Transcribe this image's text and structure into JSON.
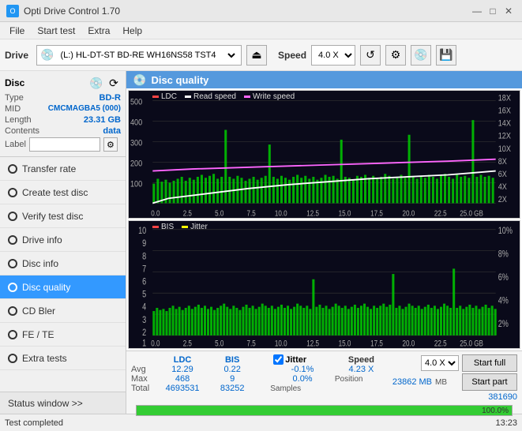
{
  "titlebar": {
    "title": "Opti Drive Control 1.70",
    "icon": "O",
    "controls": [
      "—",
      "□",
      "✕"
    ]
  },
  "menubar": {
    "items": [
      "File",
      "Start test",
      "Extra",
      "Help"
    ]
  },
  "toolbar": {
    "drive_label": "Drive",
    "drive_value": "(L:) HL-DT-ST BD-RE WH16NS58 TST4",
    "speed_label": "Speed",
    "speed_value": "4.0 X"
  },
  "disc": {
    "title": "Disc",
    "type_label": "Type",
    "type_value": "BD-R",
    "mid_label": "MID",
    "mid_value": "CMCMAGBA5 (000)",
    "length_label": "Length",
    "length_value": "23.31 GB",
    "contents_label": "Contents",
    "contents_value": "data",
    "label_label": "Label",
    "label_value": ""
  },
  "nav": {
    "items": [
      {
        "id": "transfer-rate",
        "label": "Transfer rate",
        "active": false
      },
      {
        "id": "create-test-disc",
        "label": "Create test disc",
        "active": false
      },
      {
        "id": "verify-test-disc",
        "label": "Verify test disc",
        "active": false
      },
      {
        "id": "drive-info",
        "label": "Drive info",
        "active": false
      },
      {
        "id": "disc-info",
        "label": "Disc info",
        "active": false
      },
      {
        "id": "disc-quality",
        "label": "Disc quality",
        "active": true
      },
      {
        "id": "cd-bler",
        "label": "CD Bler",
        "active": false
      },
      {
        "id": "fe-te",
        "label": "FE / TE",
        "active": false
      },
      {
        "id": "extra-tests",
        "label": "Extra tests",
        "active": false
      }
    ]
  },
  "status_window": "Status window >>",
  "disc_quality": {
    "title": "Disc quality",
    "chart1": {
      "legend": [
        {
          "label": "LDC",
          "color": "#ff4444"
        },
        {
          "label": "Read speed",
          "color": "#ffffff"
        },
        {
          "label": "Write speed",
          "color": "#ff66ff"
        }
      ],
      "y_left": [
        "500",
        "400",
        "300",
        "200",
        "100"
      ],
      "y_right": [
        "18X",
        "16X",
        "14X",
        "12X",
        "10X",
        "8X",
        "6X",
        "4X",
        "2X"
      ],
      "x_labels": [
        "0.0",
        "2.5",
        "5.0",
        "7.5",
        "10.0",
        "12.5",
        "15.0",
        "17.5",
        "20.0",
        "22.5",
        "25.0 GB"
      ]
    },
    "chart2": {
      "legend": [
        {
          "label": "BIS",
          "color": "#ff4444"
        },
        {
          "label": "Jitter",
          "color": "#ffff00"
        }
      ],
      "y_left": [
        "10",
        "9",
        "8",
        "7",
        "6",
        "5",
        "4",
        "3",
        "2",
        "1"
      ],
      "y_right": [
        "10%",
        "8%",
        "6%",
        "4%",
        "2%"
      ],
      "x_labels": [
        "0.0",
        "2.5",
        "5.0",
        "7.5",
        "10.0",
        "12.5",
        "15.0",
        "17.5",
        "20.0",
        "22.5",
        "25.0 GB"
      ]
    }
  },
  "stats": {
    "headers": [
      "LDC",
      "BIS",
      "",
      "Jitter",
      "Speed",
      ""
    ],
    "rows": [
      {
        "label": "Avg",
        "ldc": "12.29",
        "bis": "0.22",
        "jitter": "-0.1%",
        "speed": "4.23 X"
      },
      {
        "label": "Max",
        "ldc": "468",
        "bis": "9",
        "jitter": "0.0%",
        "position": "23862 MB"
      },
      {
        "label": "Total",
        "ldc": "4693531",
        "bis": "83252",
        "samples": "381690"
      }
    ],
    "jitter_checked": true,
    "jitter_label": "Jitter",
    "speed_label": "Speed",
    "speed_dropdown": "4.0 X",
    "position_label": "Position",
    "samples_label": "Samples",
    "btn_start_full": "Start full",
    "btn_start_part": "Start part"
  },
  "progress": {
    "value": 100,
    "text": "100.0%"
  },
  "statusbar": {
    "text": "Test completed",
    "time": "13:23"
  },
  "colors": {
    "accent": "#3399ff",
    "active_nav": "#3399ff",
    "ldc_color": "#ff4444",
    "bis_color": "#ff4444",
    "jitter_color": "#ffff00",
    "read_speed_color": "#ffffff",
    "green_bars": "#00cc00"
  }
}
